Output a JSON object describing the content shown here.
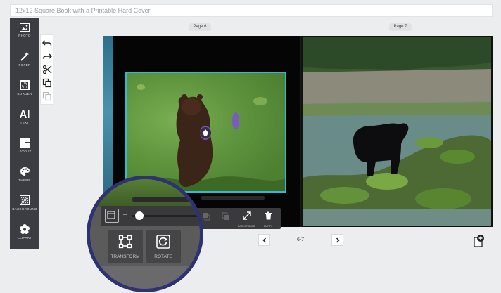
{
  "title": "12x12 Square Book with a Printable Hard Cover",
  "sidebar": {
    "items": [
      {
        "label": "PHOTO",
        "icon": "image-icon"
      },
      {
        "label": "FILTER",
        "icon": "magic-wand-icon"
      },
      {
        "label": "BORDER",
        "icon": "border-icon"
      },
      {
        "label": "TEXT",
        "icon": "text-icon"
      },
      {
        "label": "LAYOUT",
        "icon": "layout-icon"
      },
      {
        "label": "THEME",
        "icon": "palette-icon"
      },
      {
        "label": "BACKGROUND",
        "icon": "background-icon"
      },
      {
        "label": "CLIPART",
        "icon": "flower-icon"
      }
    ]
  },
  "tools": [
    {
      "icon": "undo-icon"
    },
    {
      "icon": "redo-icon"
    },
    {
      "icon": "cut-icon"
    },
    {
      "icon": "copy-icon"
    },
    {
      "icon": "paste-icon"
    }
  ],
  "pages": {
    "left_label": "Page 6",
    "right_label": "Page 7"
  },
  "nav": {
    "prev_icon": "chevron-left-icon",
    "next_icon": "chevron-right-icon",
    "page_range": "6-7"
  },
  "photo_toolbar": {
    "items": [
      {
        "label": "",
        "icon": "bring-forward-icon"
      },
      {
        "label": "",
        "icon": "send-backward-icon"
      },
      {
        "label": "BACKGROUND",
        "icon": "expand-icon"
      },
      {
        "label": "EMPTY",
        "icon": "trash-icon"
      }
    ]
  },
  "magnifier": {
    "zoom_minus": "–",
    "transform_label": "TRANSFORM",
    "rotate_label": "ROTATE"
  },
  "colors": {
    "sidebar_bg": "#3b3d42",
    "selection_border": "#35b8d6",
    "magnifier_ring": "#2e3270"
  }
}
